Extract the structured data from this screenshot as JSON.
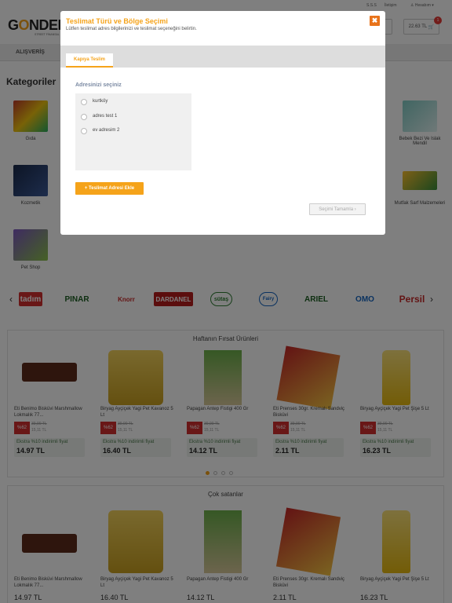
{
  "topbar": {
    "link1": "S.S.S",
    "link2": "İletişim",
    "account": "Hesabım"
  },
  "header": {
    "logo_text": "GÖNDER",
    "logo_sub": "STREET FİNANSAL",
    "cart_total": "22.63 TL",
    "cart_count": "1"
  },
  "nav": {
    "label": "ALIŞVERİŞ"
  },
  "categories": {
    "title": "Kategoriler",
    "left": [
      "Gıda",
      "Kozmetik",
      "Pet Shop"
    ],
    "right": [
      "Bebek Bezi Ve Islak Mendil",
      "Mutfak Sarf Malzemeleri"
    ]
  },
  "brands": [
    "tadım",
    "PINAR",
    "Knorr",
    "DARDANEL",
    "sütaş",
    "Fairy",
    "ARIEL",
    "OMO",
    "Persil"
  ],
  "deals": {
    "title": "Haftanın Fırsat Ürünleri",
    "products": [
      {
        "name": "Eti Benimo Bisküvi Marshmallow Lokmalık 77...",
        "discount": "%62",
        "old": "39,90 TL",
        "new": "15,11 TL",
        "extra_label": "Ekstra %10 indirimli fiyat",
        "extra_price": "14.97 TL"
      },
      {
        "name": "Biryag Ayçiçek Yagi Pet Kavanoz 5 Lt",
        "discount": "%62",
        "old": "39,90 TL",
        "new": "15,11 TL",
        "extra_label": "Ekstra %10 indirimli fiyat",
        "extra_price": "16.40 TL"
      },
      {
        "name": "Papagan Antep Fistigi 400 Gr",
        "discount": "%62",
        "old": "39,90 TL",
        "new": "15,11 TL",
        "extra_label": "Ekstra %10 indirimli fiyat",
        "extra_price": "14.12 TL"
      },
      {
        "name": "Eti Prenses 30gr. Kremalı Sandviç Bisküvi",
        "discount": "%62",
        "old": "39,90 TL",
        "new": "15,11 TL",
        "extra_label": "Ekstra %10 indirimli fiyat",
        "extra_price": "2.11 TL"
      },
      {
        "name": "Biryag Ayçiçek Yagi Pet Şişe 5 Lt",
        "discount": "%62",
        "old": "39,90 TL",
        "new": "15,11 TL",
        "extra_label": "Ekstra %10 indirimli fiyat",
        "extra_price": "16.23 TL"
      }
    ]
  },
  "bestsellers": {
    "title": "Çok satanlar",
    "products": [
      {
        "name": "Eti Benimo Bisküvi Marshmallow Lokmalık 77...",
        "price": "14.97 TL"
      },
      {
        "name": "Biryag Ayçiçek Yagi Pet Kavanoz 5 Lt",
        "price": "16.40 TL"
      },
      {
        "name": "Papagan Antep Fistigi 400 Gr",
        "price": "14.12 TL"
      },
      {
        "name": "Eti Prenses 30gr. Kremalı Sandviç Bisküvi",
        "price": "2.11 TL"
      },
      {
        "name": "Biryag Ayçiçek Yagi Pet Şişe 5 Lt",
        "price": "16.23 TL"
      }
    ]
  },
  "modal": {
    "title": "Teslimat Türü ve Bölge Seçimi",
    "subtitle": "Lütfen teslimat adres bilgilerinizi ve teslimat seçeneğini belirtin.",
    "close_icon": "close-icon",
    "tab": "Kapıya Teslim",
    "address_label": "Adresinizi seçiniz",
    "addresses": [
      "kurtköy",
      "adres test 1",
      "ev adresim 2"
    ],
    "add_button": "+ Teslimat Adresi Ekle",
    "confirm_button": "Seçimi Tamamla ›"
  },
  "colors": {
    "accent": "#f5a31a",
    "close": "#e8731a",
    "discount": "#d32f2f"
  }
}
